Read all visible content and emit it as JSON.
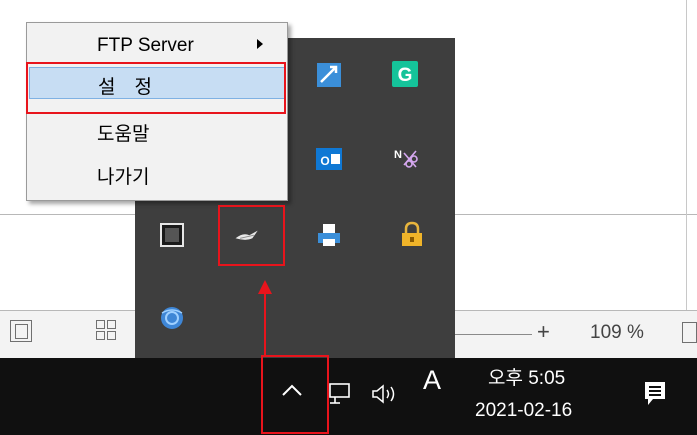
{
  "context_menu": {
    "items": [
      {
        "label": "FTP Server",
        "has_submenu": true
      },
      {
        "label": "설정",
        "selected": true
      },
      {
        "label": "도움말"
      },
      {
        "label": "나가기"
      }
    ]
  },
  "status_bar": {
    "zoom_level": "109 %",
    "zoom_plus": "+"
  },
  "taskbar": {
    "ime_indicator": "A",
    "clock_time": "오후 5:05",
    "clock_date": "2021-02-16"
  },
  "tray_icons": [
    "remote-desktop-icon",
    "grammarly-icon",
    "outlook-icon",
    "onenote-clipper-icon",
    "app-window-icon",
    "ftp-server-icon",
    "printer-icon",
    "lock-icon",
    "globe-sync-icon"
  ],
  "colors": {
    "annotation": "#e8141c",
    "selection": "#c7ddf3",
    "taskbar": "#101010",
    "flyout": "#3e3e3e"
  }
}
